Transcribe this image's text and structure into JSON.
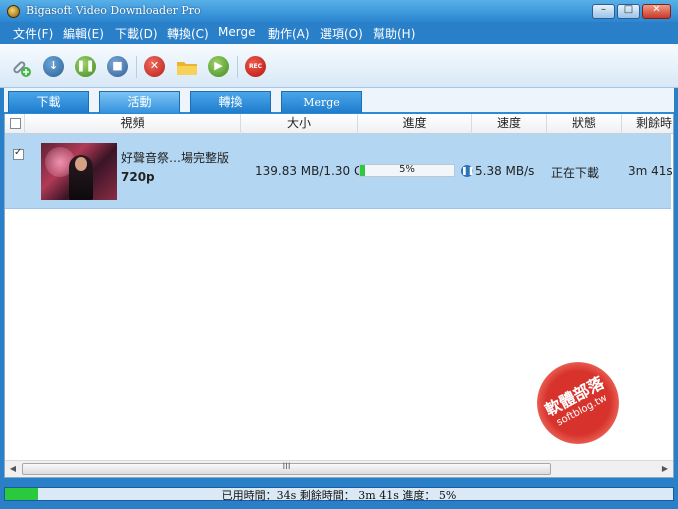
{
  "window": {
    "title": "Bigasoft Video Downloader Pro"
  },
  "menu": [
    "文件(F)",
    "編輯(E)",
    "下載(D)",
    "轉換(C)",
    "Merge",
    "動作(A)",
    "選項(O)",
    "幫助(H)"
  ],
  "toolbar": {
    "icons": [
      "add-link-icon",
      "download-icon",
      "pause-icon",
      "stop-icon",
      "delete-icon",
      "folder-icon",
      "play-icon",
      "record-icon"
    ],
    "rec_label": "REC"
  },
  "tabs": [
    "下載",
    "活動",
    "轉換",
    "Merge"
  ],
  "table": {
    "headers": [
      "視頻",
      "大小",
      "進度",
      "速度",
      "狀態",
      "剩餘時間"
    ],
    "rows": [
      {
        "checked": true,
        "title": "好聲音祭…場完整版",
        "quality": "720p",
        "size": "139.83 MB/1.30 GB",
        "progress_label": "5%",
        "progress_percent": 5,
        "speed": "5.38 MB/s",
        "status": "正在下載",
        "remaining": "3m 41s"
      }
    ]
  },
  "scrollbar": {
    "grip": "III"
  },
  "watermark": {
    "title": "軟體部落",
    "url": "softblog.tw"
  },
  "status": {
    "text": "已用時間：34s 剩餘時間： 3m 41s 進度： 5%",
    "progress_percent": 5
  },
  "colors": {
    "accent": "#2a7fc9",
    "row_selected": "#b3d7f3",
    "progress_fill": "#2fc83f"
  }
}
